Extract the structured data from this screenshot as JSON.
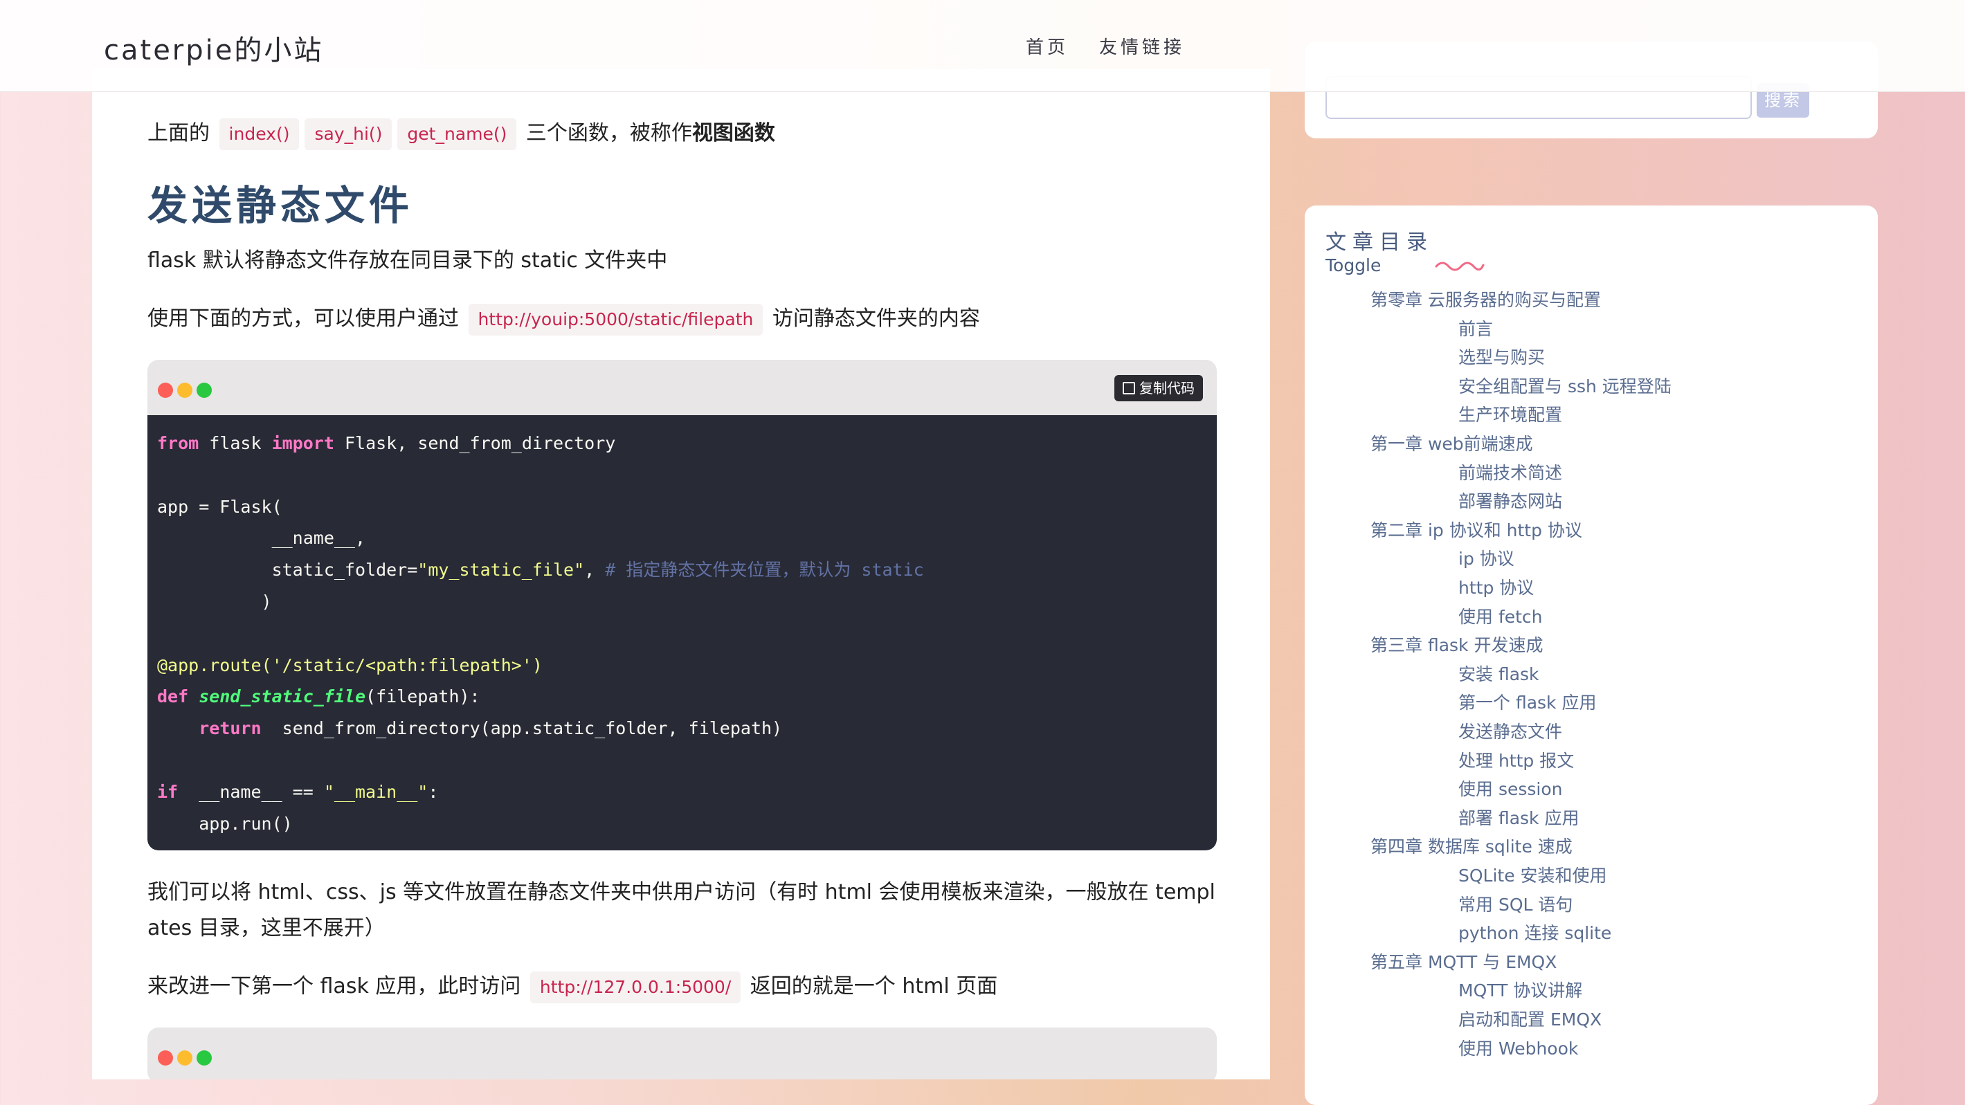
{
  "header": {
    "site_title": "caterpie的小站",
    "nav": [
      "首页",
      "友情链接"
    ]
  },
  "article": {
    "p1": {
      "before": "上面的",
      "codes": [
        "index()",
        "say_hi()",
        "get_name()"
      ],
      "mid": "三个函数，被称作",
      "bold": "视图函数"
    },
    "h2": "发送静态文件",
    "p2": "flask 默认将静态文件存放在同目录下的 static 文件夹中",
    "p3": {
      "before": "使用下面的方式，可以使用户通过",
      "code": "http://youip:5000/static/filepath",
      "after": "访问静态文件夹的内容"
    },
    "copy_label": "复制代码",
    "code_lines": [
      {
        "segs": [
          [
            "kw",
            "from"
          ],
          [
            "",
            "flask "
          ],
          [
            "kw",
            "import"
          ],
          [
            "",
            "Flask, send_from_directory"
          ]
        ]
      },
      {
        "segs": []
      },
      {
        "segs": [
          [
            "",
            "app = Flask("
          ]
        ]
      },
      {
        "segs": [
          [
            "",
            "           __name__,"
          ]
        ]
      },
      {
        "segs": [
          [
            "",
            "           static_folder="
          ],
          [
            "str",
            "\"my_static_file\""
          ],
          [
            "",
            ", "
          ],
          [
            "cm",
            "# 指定静态文件夹位置，默认为 static"
          ]
        ]
      },
      {
        "segs": [
          [
            "",
            "          )"
          ]
        ]
      },
      {
        "segs": []
      },
      {
        "segs": [
          [
            "dec",
            "@app.route('/static/<path:filepath>')"
          ]
        ]
      },
      {
        "segs": [
          [
            "kw",
            "def"
          ],
          [
            "",
            ""
          ],
          [
            "fn",
            "send_static_file"
          ],
          [
            "",
            "(filepath):"
          ]
        ]
      },
      {
        "segs": [
          [
            "",
            "    "
          ],
          [
            "kw",
            "return"
          ],
          [
            "",
            " send_from_directory(app.static_folder, filepath)"
          ]
        ]
      },
      {
        "segs": []
      },
      {
        "segs": [
          [
            "kw",
            "if"
          ],
          [
            "",
            " __name__ == "
          ],
          [
            "str",
            "\"__main__\""
          ],
          [
            "",
            ":"
          ]
        ]
      },
      {
        "segs": [
          [
            "",
            "    app.run()"
          ]
        ]
      }
    ],
    "p4_line1": "我们可以将 html、css、js 等文件放置在静态文件夹中供用户访问（有时 html 会使用模板来渲染，一般放在 templ",
    "p4_line2": "ates 目录，这里不展开）",
    "p5": {
      "before": "来改进一下第一个 flask 应用，此时访问",
      "code": "http://127.0.0.1:5000/",
      "after": "返回的就是一个 html 页面"
    }
  },
  "search": {
    "button_label": "搜索"
  },
  "toc": {
    "title": "文章目录",
    "toggle": "Toggle",
    "items": [
      {
        "level": 1,
        "text": "第零章 云服务器的购买与配置"
      },
      {
        "level": 2,
        "text": "前言"
      },
      {
        "level": 2,
        "text": "选型与购买"
      },
      {
        "level": 2,
        "text": "安全组配置与 ssh 远程登陆"
      },
      {
        "level": 2,
        "text": "生产环境配置"
      },
      {
        "level": 1,
        "text": "第一章 web前端速成"
      },
      {
        "level": 2,
        "text": "前端技术简述"
      },
      {
        "level": 2,
        "text": "部署静态网站"
      },
      {
        "level": 1,
        "text": "第二章 ip 协议和 http 协议"
      },
      {
        "level": 2,
        "text": "ip 协议"
      },
      {
        "level": 2,
        "text": "http 协议"
      },
      {
        "level": 2,
        "text": "使用 fetch"
      },
      {
        "level": 1,
        "text": "第三章 flask 开发速成"
      },
      {
        "level": 2,
        "text": "安装 flask"
      },
      {
        "level": 2,
        "text": "第一个 flask 应用"
      },
      {
        "level": 2,
        "text": "发送静态文件"
      },
      {
        "level": 2,
        "text": "处理 http 报文"
      },
      {
        "level": 2,
        "text": "使用 session"
      },
      {
        "level": 2,
        "text": "部署 flask 应用"
      },
      {
        "level": 1,
        "text": "第四章 数据库 sqlite 速成"
      },
      {
        "level": 2,
        "text": "SQLite 安装和使用"
      },
      {
        "level": 2,
        "text": "常用 SQL 语句"
      },
      {
        "level": 2,
        "text": "python 连接 sqlite"
      },
      {
        "level": 1,
        "text": "第五章 MQTT 与 EMQX"
      },
      {
        "level": 2,
        "text": "MQTT 协议讲解"
      },
      {
        "level": 2,
        "text": "启动和配置 EMQX"
      },
      {
        "level": 2,
        "text": "使用 Webhook"
      }
    ]
  }
}
